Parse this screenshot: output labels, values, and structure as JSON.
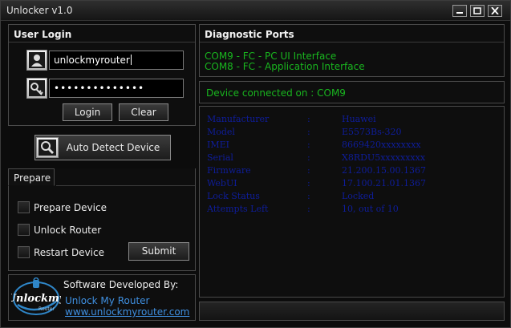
{
  "window": {
    "title": "Unlocker v1.0"
  },
  "login": {
    "header": "User Login",
    "username": "unlockmyrouter",
    "password": "••••••••••••••",
    "login_label": "Login",
    "clear_label": "Clear"
  },
  "auto_detect": {
    "label": "Auto Detect Device"
  },
  "prepare": {
    "tab_label": "Prepare",
    "options": [
      "Prepare Device",
      "Unlock Router",
      "Restart Device"
    ],
    "submit_label": "Submit"
  },
  "developer": {
    "heading": "Software Developed By:",
    "name": "Unlock My Router",
    "url": "www.unlockmyrouter.com",
    "logo_text": "Unlockmy",
    "logo_subtext": "Router"
  },
  "ports": {
    "header": "Diagnostic Ports",
    "lines": [
      "COM9 - FC - PC UI Interface",
      "COM8 - FC - Application Interface"
    ]
  },
  "connection": {
    "status": "Device connected on : COM9"
  },
  "device_info": {
    "rows": [
      {
        "label": "Manufacturer",
        "sep": ":",
        "value": "Huawei"
      },
      {
        "label": "Model",
        "sep": ":",
        "value": "E5573Bs-320"
      },
      {
        "label": "IMEI",
        "sep": ":",
        "value": "8669420xxxxxxxx"
      },
      {
        "label": "Serial",
        "sep": ":",
        "value": "X8RDU5xxxxxxxxx"
      },
      {
        "label": "Firmware",
        "sep": ":",
        "value": "21.200.15.00.1367"
      },
      {
        "label": "WebUI",
        "sep": ":",
        "value": "17.100.21.01.1367"
      },
      {
        "label": "Lock Status",
        "sep": ":",
        "value": "Locked"
      },
      {
        "label": "Attempts Left",
        "sep": ":",
        "value": "10, out of 10"
      }
    ]
  },
  "colors": {
    "green_text": "#19b51f",
    "info_text": "#0e1d9a",
    "background": "#0c0c0c"
  }
}
